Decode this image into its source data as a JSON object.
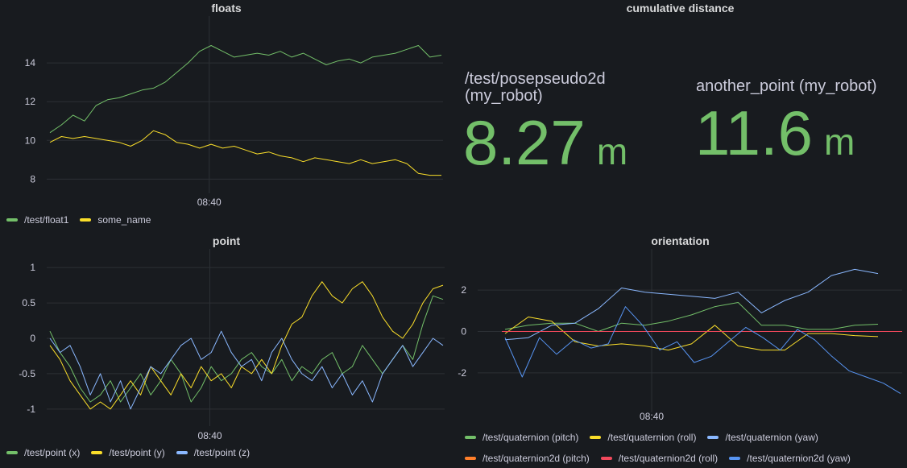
{
  "panels": {
    "floats": {
      "title": "floats",
      "chart_data": {
        "type": "line",
        "yticks": [
          "8",
          "10",
          "12",
          "14"
        ],
        "ytick_values": [
          8,
          10,
          12,
          14
        ],
        "ylim": [
          7.6,
          16
        ],
        "xtick": "08:40",
        "xtick_pos": 0.41,
        "grid": true,
        "series": [
          {
            "name": "/test/float1",
            "color": "#73bf69",
            "values": [
              10.4,
              10.8,
              11.3,
              11.0,
              11.8,
              12.1,
              12.2,
              12.4,
              12.6,
              12.7,
              13.0,
              13.5,
              14.0,
              14.6,
              14.9,
              14.6,
              14.3,
              14.4,
              14.5,
              14.4,
              14.6,
              14.3,
              14.5,
              14.2,
              13.9,
              14.1,
              14.2,
              14.0,
              14.3,
              14.4,
              14.5,
              14.7,
              14.9,
              14.3,
              14.4
            ],
            "label_legend": "/test/float1"
          },
          {
            "name": "some_name",
            "color": "#fade2a",
            "values": [
              9.9,
              10.2,
              10.1,
              10.2,
              10.1,
              10.0,
              9.9,
              9.7,
              10.0,
              10.5,
              10.3,
              9.9,
              9.8,
              9.6,
              9.8,
              9.6,
              9.7,
              9.5,
              9.3,
              9.4,
              9.2,
              9.1,
              8.9,
              9.1,
              9.0,
              8.9,
              8.8,
              9.0,
              8.8,
              8.9,
              9.0,
              8.8,
              8.3,
              8.2,
              8.2
            ],
            "label_legend": "some_name"
          }
        ]
      }
    },
    "distance": {
      "title": "cumulative distance",
      "stats": [
        {
          "label": "/test/posepseudo2d\n(my_robot)",
          "value": "8.27",
          "unit": "m"
        },
        {
          "label": "another_point (my_robot)",
          "value": "11.6",
          "unit": "m"
        }
      ]
    },
    "point": {
      "title": "point",
      "chart_data": {
        "type": "line",
        "yticks": [
          "-1",
          "-0.5",
          "0",
          "0.5",
          "1"
        ],
        "ytick_values": [
          -1,
          -0.5,
          0,
          0.5,
          1
        ],
        "ylim": [
          -1.15,
          1.15
        ],
        "xtick": "08:40",
        "xtick_pos": 0.41,
        "grid": true,
        "series": [
          {
            "name": "/test/point (x)",
            "color": "#73bf69",
            "values": [
              0.1,
              -0.2,
              -0.4,
              -0.7,
              -0.9,
              -0.8,
              -0.6,
              -0.9,
              -0.7,
              -0.5,
              -0.8,
              -0.6,
              -0.3,
              -0.5,
              -0.9,
              -0.7,
              -0.4,
              -0.6,
              -0.5,
              -0.3,
              -0.2,
              -0.4,
              -0.5,
              -0.3,
              -0.6,
              -0.4,
              -0.5,
              -0.3,
              -0.2,
              -0.5,
              -0.4,
              -0.1,
              -0.3,
              -0.5,
              -0.3,
              -0.1,
              -0.3,
              0.2,
              0.6,
              0.55
            ]
          },
          {
            "name": "/test/point (y)",
            "color": "#fade2a",
            "values": [
              -0.1,
              -0.3,
              -0.6,
              -0.8,
              -1.0,
              -0.9,
              -1.0,
              -0.8,
              -0.6,
              -0.8,
              -0.4,
              -0.6,
              -0.8,
              -0.5,
              -0.7,
              -0.4,
              -0.6,
              -0.5,
              -0.7,
              -0.4,
              -0.5,
              -0.3,
              -0.5,
              -0.1,
              0.2,
              0.3,
              0.6,
              0.8,
              0.6,
              0.5,
              0.7,
              0.8,
              0.6,
              0.3,
              0.1,
              0.0,
              0.2,
              0.5,
              0.7,
              0.75
            ]
          },
          {
            "name": "/test/point (z)",
            "color": "#8ab8ff",
            "values": [
              0.0,
              -0.2,
              -0.1,
              -0.4,
              -0.8,
              -0.5,
              -0.9,
              -0.6,
              -1.0,
              -0.7,
              -0.4,
              -0.5,
              -0.3,
              -0.1,
              0.0,
              -0.3,
              -0.2,
              0.1,
              -0.2,
              -0.4,
              -0.3,
              -0.6,
              -0.2,
              0.0,
              -0.3,
              -0.5,
              -0.6,
              -0.4,
              -0.7,
              -0.5,
              -0.8,
              -0.6,
              -0.9,
              -0.5,
              -0.3,
              -0.1,
              -0.4,
              -0.2,
              0.0,
              -0.1
            ]
          }
        ]
      }
    },
    "orientation": {
      "title": "orientation",
      "chart_data": {
        "type": "line",
        "yticks": [
          "-2",
          "0",
          "2"
        ],
        "ytick_values": [
          -2,
          0,
          2
        ],
        "ylim": [
          -3.6,
          3.6
        ],
        "xtick": "08:40",
        "xtick_pos": 0.41,
        "grid": true,
        "series": [
          {
            "name": "/test/quaternion (pitch)",
            "color": "#73bf69",
            "values": [
              0.1,
              0.3,
              0.4,
              0.4,
              0.0,
              0.4,
              0.3,
              0.5,
              0.8,
              1.2,
              1.4,
              0.3,
              0.3,
              0.1,
              0.1,
              0.3,
              0.35
            ]
          },
          {
            "name": "/test/quaternion (roll)",
            "color": "#fade2a",
            "values": [
              -0.1,
              0.7,
              0.5,
              -0.5,
              -0.7,
              -0.6,
              -0.7,
              -0.9,
              -0.6,
              0.3,
              -0.7,
              -0.9,
              -0.9,
              -0.1,
              -0.1,
              -0.2,
              -0.25
            ]
          },
          {
            "name": "/test/quaternion (yaw)",
            "color": "#8ab8ff",
            "values": [
              -0.4,
              -0.3,
              0.3,
              0.4,
              1.1,
              2.1,
              1.9,
              1.8,
              1.7,
              1.6,
              1.9,
              0.9,
              1.5,
              1.9,
              2.7,
              3.0,
              2.8
            ]
          },
          {
            "name": "/test/quaternion2d (pitch)",
            "color": "#ff7f2a",
            "values": [
              0,
              0
            ]
          },
          {
            "name": "/test/quaternion2d (roll)",
            "color": "#f2495c",
            "values": [
              0,
              0
            ]
          },
          {
            "name": "/test/quaternion2d (yaw)",
            "color": "#5794f2",
            "values": [
              -0.3,
              -2.2,
              -0.3,
              -1.1,
              -0.4,
              -0.8,
              -0.6,
              1.2,
              0.3,
              -0.9,
              -0.5,
              -1.5,
              -1.2,
              -0.5,
              0.2,
              -0.3,
              -0.9,
              0.1,
              -0.4,
              -1.2,
              -1.9,
              -2.2,
              -2.5,
              -3.0
            ]
          }
        ]
      }
    }
  }
}
